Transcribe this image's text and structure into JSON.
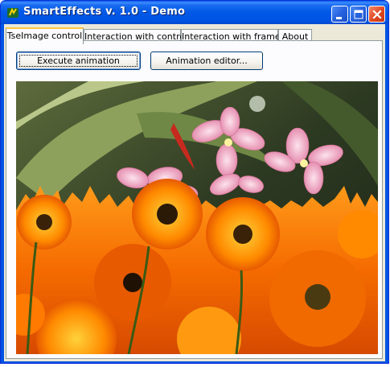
{
  "window": {
    "title": "SmartEffects v. 1.0 - Demo"
  },
  "tabs": [
    {
      "label": "TseImage control",
      "active": true
    },
    {
      "label": "Interaction with controls",
      "active": false
    },
    {
      "label": "Interaction with frames",
      "active": false
    },
    {
      "label": "About",
      "active": false
    }
  ],
  "buttons": {
    "execute_label": "Execute animation",
    "editor_label": "Animation editor..."
  },
  "image": {
    "subject": "flowers-photo",
    "colors": {
      "orange": "#ff8c00",
      "pink": "#f3b6c8",
      "leaf": "#5f7a3a"
    }
  },
  "icons": [
    "app-icon",
    "minimize-icon",
    "maximize-icon",
    "close-icon"
  ]
}
